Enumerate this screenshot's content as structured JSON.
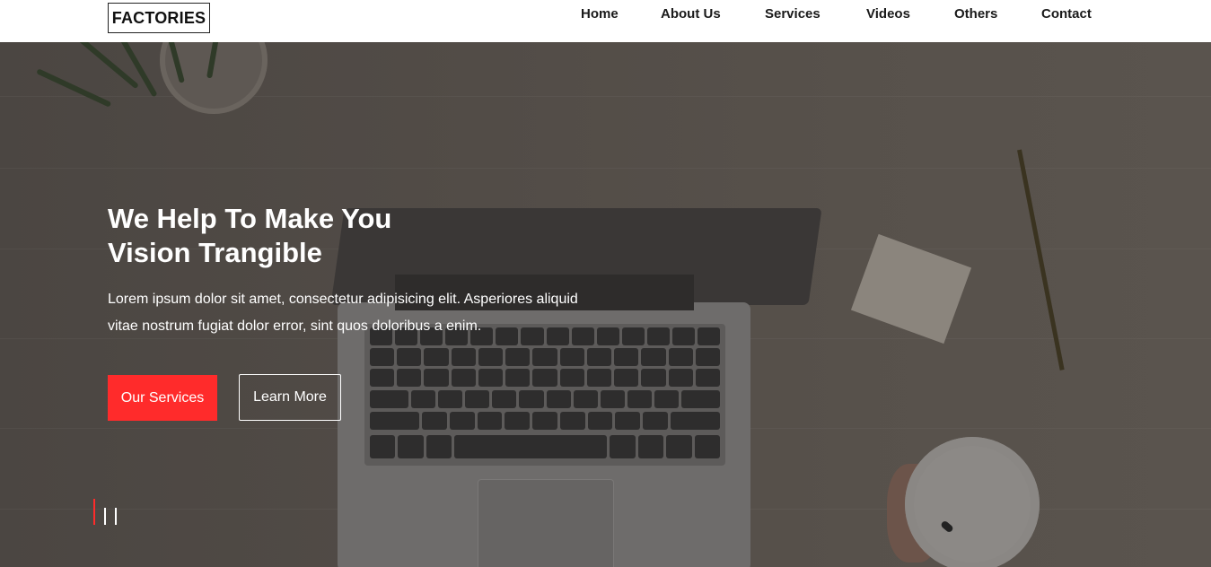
{
  "header": {
    "logo_text": "FACTORIES",
    "nav": [
      {
        "label": "Home"
      },
      {
        "label": "About Us"
      },
      {
        "label": "Services"
      },
      {
        "label": "Videos"
      },
      {
        "label": "Others"
      },
      {
        "label": "Contact"
      }
    ]
  },
  "hero": {
    "headline_line1": "We Help To Make You",
    "headline_line2": "Vision Trangible",
    "lead_line1": "Lorem ipsum dolor sit amet, consectetur adipisicing elit. Asperiores aliquid",
    "lead_line2": "vitae nostrum fugiat dolor error, sint quos doloribus a enim.",
    "primary_button_label": "Our Services",
    "secondary_button_label": "Learn More",
    "slide_indicator_active": 1,
    "slide_indicator_total": 3
  },
  "colors": {
    "accent": "#ff2b2b",
    "header_bg": "#ffffff",
    "nav_text": "#1a1a1a",
    "hero_text": "#ffffff"
  }
}
